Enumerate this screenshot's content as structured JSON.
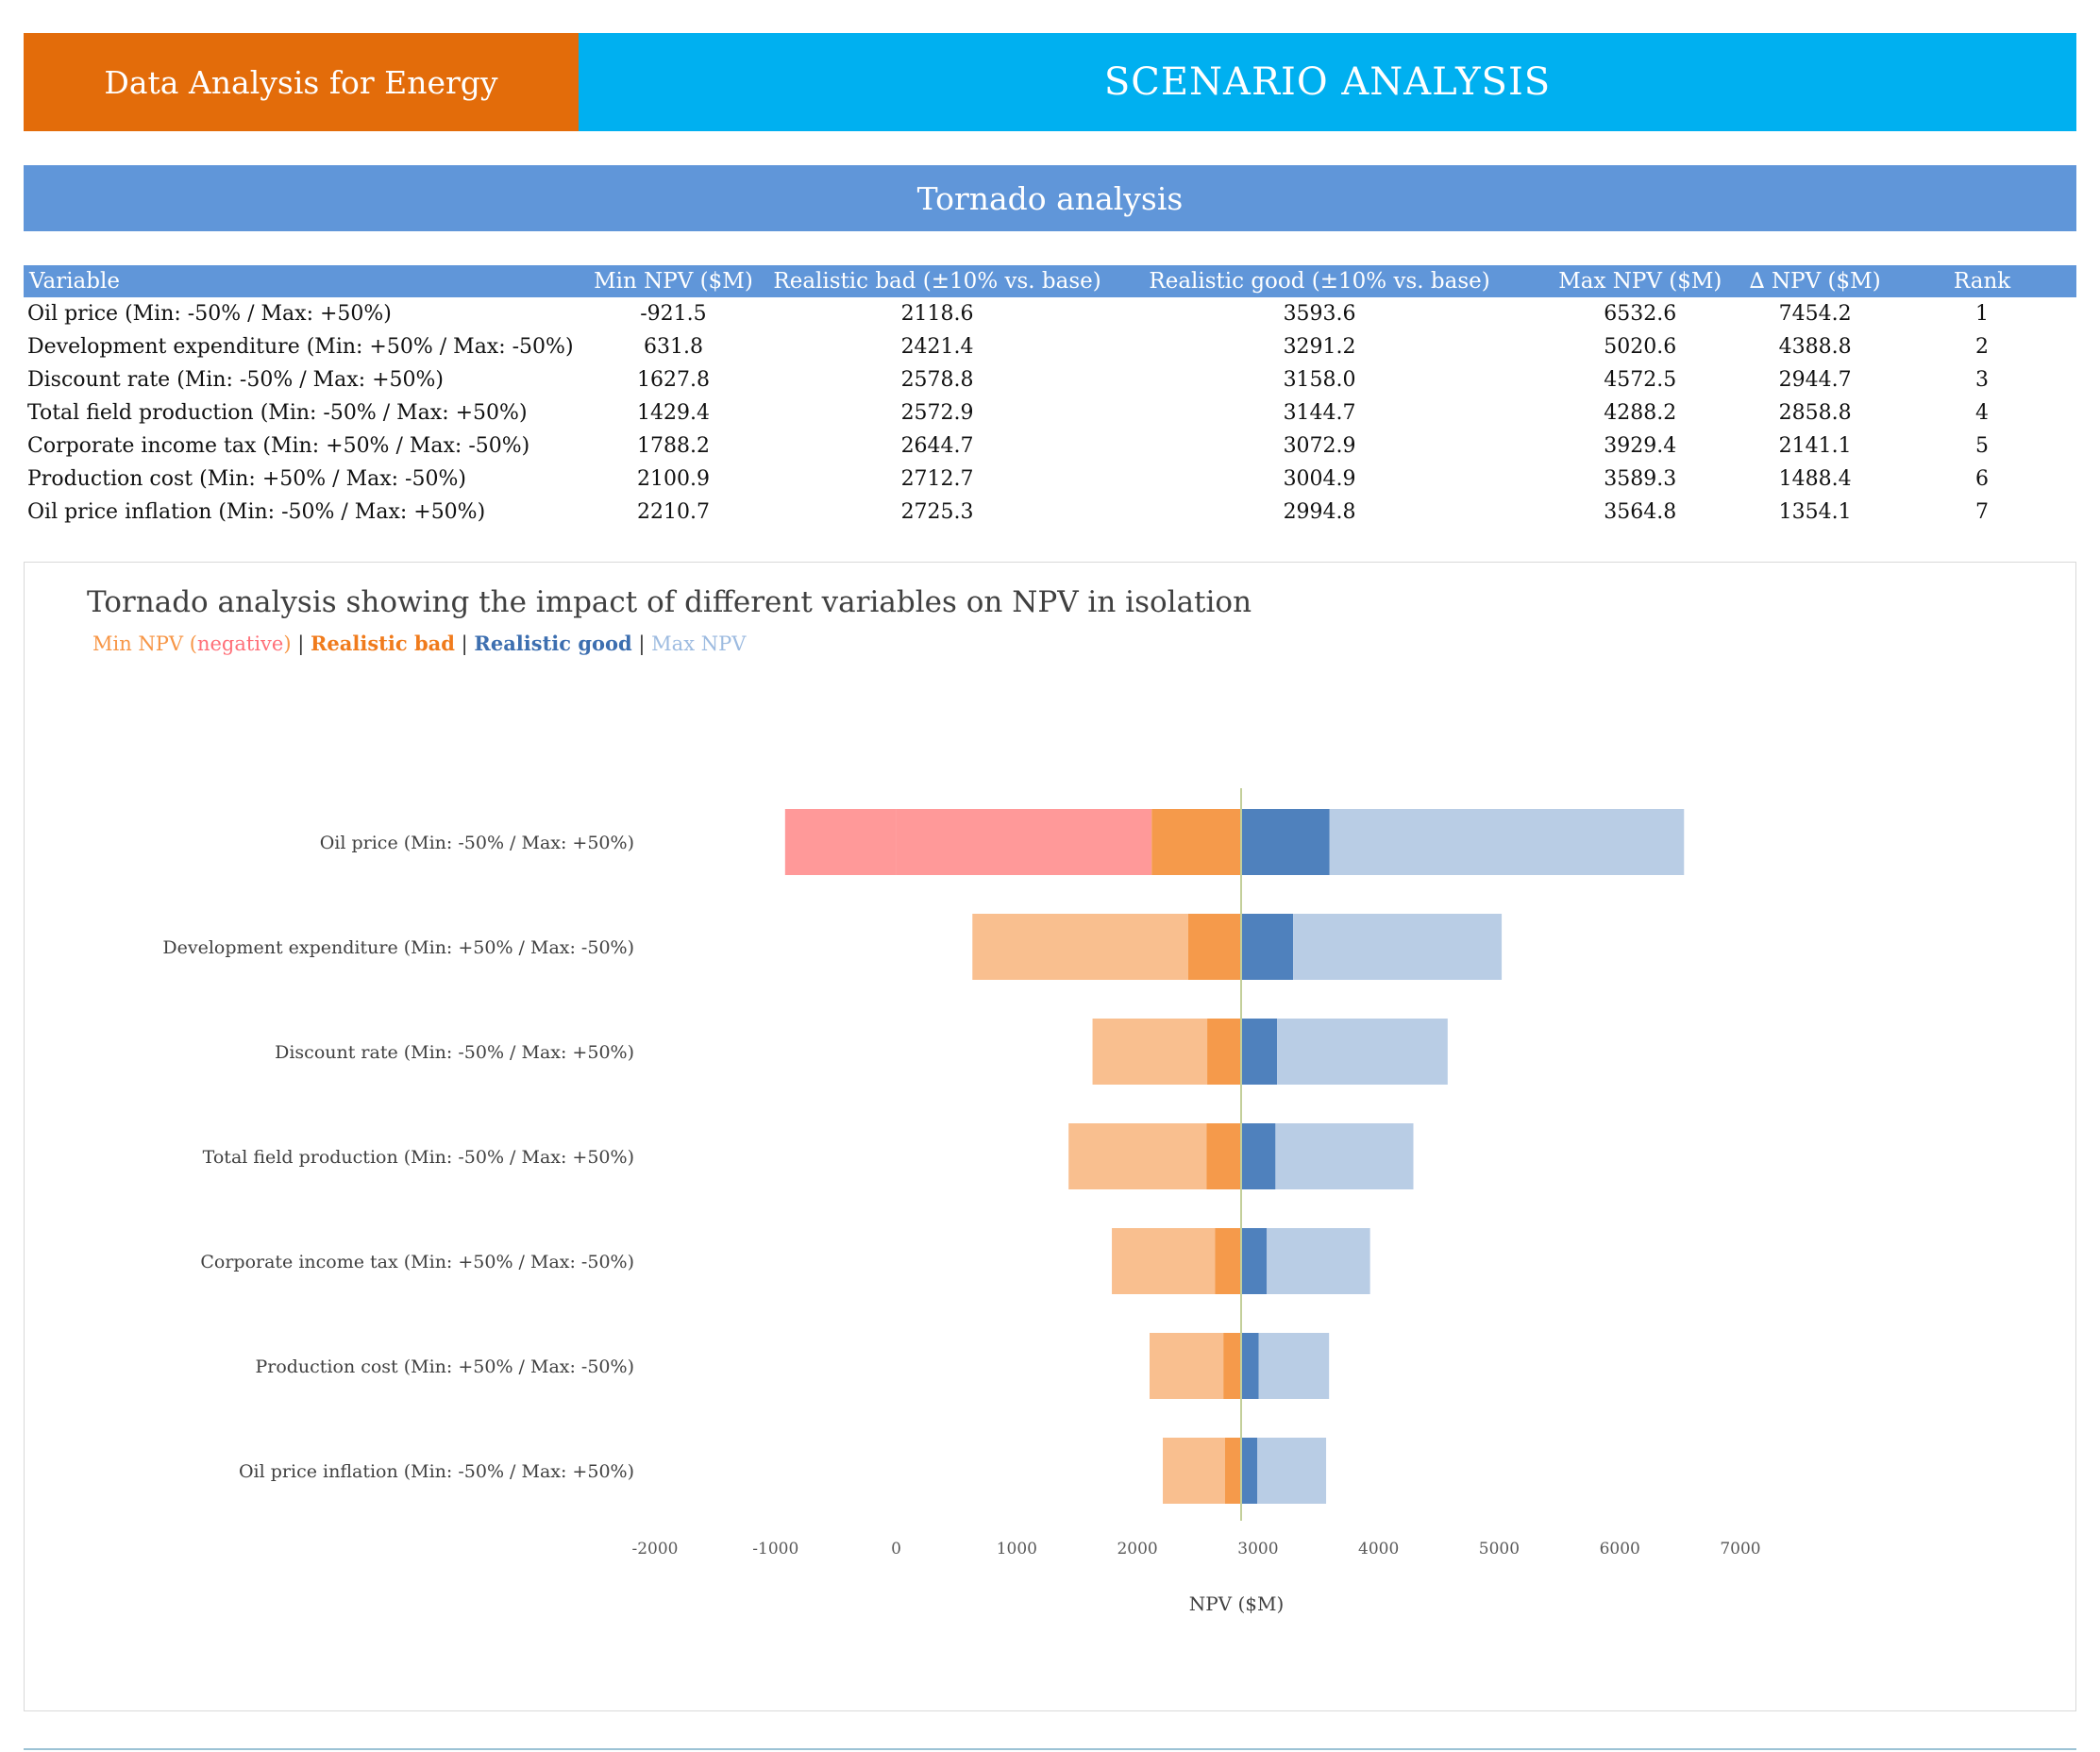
{
  "header": {
    "brand": "Data Analysis for Energy",
    "title": "SCENARIO ANALYSIS"
  },
  "section": {
    "title": "Tornado analysis"
  },
  "table": {
    "columns": [
      "Variable",
      "Min NPV ($M)",
      "Realistic bad (±10% vs. base)",
      "Realistic good (±10% vs. base)",
      "Max NPV ($M)",
      "∆ NPV ($M)",
      "Rank"
    ],
    "rows": [
      [
        "Oil price (Min: -50% / Max: +50%)",
        "-921.5",
        "2118.6",
        "3593.6",
        "6532.6",
        "7454.2",
        "1"
      ],
      [
        "Development expenditure (Min: +50% / Max: -50%)",
        "631.8",
        "2421.4",
        "3291.2",
        "5020.6",
        "4388.8",
        "2"
      ],
      [
        "Discount rate (Min: -50% / Max: +50%)",
        "1627.8",
        "2578.8",
        "3158.0",
        "4572.5",
        "2944.7",
        "3"
      ],
      [
        "Total field production (Min: -50% / Max: +50%)",
        "1429.4",
        "2572.9",
        "3144.7",
        "4288.2",
        "2858.8",
        "4"
      ],
      [
        "Corporate income tax (Min: +50% / Max: -50%)",
        "1788.2",
        "2644.7",
        "3072.9",
        "3929.4",
        "2141.1",
        "5"
      ],
      [
        "Production cost (Min: +50% / Max: -50%)",
        "2100.9",
        "2712.7",
        "3004.9",
        "3589.3",
        "1488.4",
        "6"
      ],
      [
        "Oil price inflation (Min: -50% / Max: +50%)",
        "2210.7",
        "2725.3",
        "2994.8",
        "3564.8",
        "1354.1",
        "7"
      ]
    ]
  },
  "chart_data": {
    "type": "bar",
    "orientation": "horizontal",
    "title": "Tornado analysis showing the impact of different variables on NPV in isolation",
    "legend_text": [
      {
        "text": "Min NPV (",
        "color": "#f79646"
      },
      {
        "text": "negative",
        "color": "#ff6f78"
      },
      {
        "text": ")",
        "color": "#f79646"
      },
      {
        "text": " | ",
        "color": "#333333"
      },
      {
        "text": "Realistic bad",
        "color": "#f07b1c",
        "bold": true
      },
      {
        "text": " | ",
        "color": "#333333"
      },
      {
        "text": "Realistic good",
        "color": "#3d6fb0",
        "bold": true
      },
      {
        "text": " | ",
        "color": "#333333"
      },
      {
        "text": "Max NPV",
        "color": "#9dbbe0"
      }
    ],
    "xlabel": "NPV ($M)",
    "xlim": [
      -2000,
      7000
    ],
    "xticks": [
      -2000,
      -1000,
      0,
      1000,
      2000,
      3000,
      4000,
      5000,
      6000,
      7000
    ],
    "base_npv": 2860,
    "colors": {
      "min_negative": "#ff9999",
      "min": "#f9bf8f",
      "realistic_bad": "#f59a4b",
      "realistic_good": "#4f81bd",
      "max": "#b9cde5",
      "base_line": "#c3cf9a"
    },
    "categories": [
      "Oil price (Min: -50% / Max: +50%)",
      "Development expenditure (Min: +50% / Max: -50%)",
      "Discount rate (Min: -50% / Max: +50%)",
      "Total field production (Min: -50% / Max: +50%)",
      "Corporate income tax (Min: +50% / Max: -50%)",
      "Production cost (Min: +50% / Max: -50%)",
      "Oil price inflation (Min: -50% / Max: +50%)"
    ],
    "series": [
      {
        "name": "Min NPV",
        "values": [
          -921.5,
          631.8,
          1627.8,
          1429.4,
          1788.2,
          2100.9,
          2210.7
        ]
      },
      {
        "name": "Realistic bad",
        "values": [
          2118.6,
          2421.4,
          2578.8,
          2572.9,
          2644.7,
          2712.7,
          2725.3
        ]
      },
      {
        "name": "Realistic good",
        "values": [
          3593.6,
          3291.2,
          3158.0,
          3144.7,
          3072.9,
          3004.9,
          2994.8
        ]
      },
      {
        "name": "Max NPV",
        "values": [
          6532.6,
          5020.6,
          4572.5,
          4288.2,
          3929.4,
          3589.3,
          3564.8
        ]
      }
    ],
    "grid": false
  }
}
